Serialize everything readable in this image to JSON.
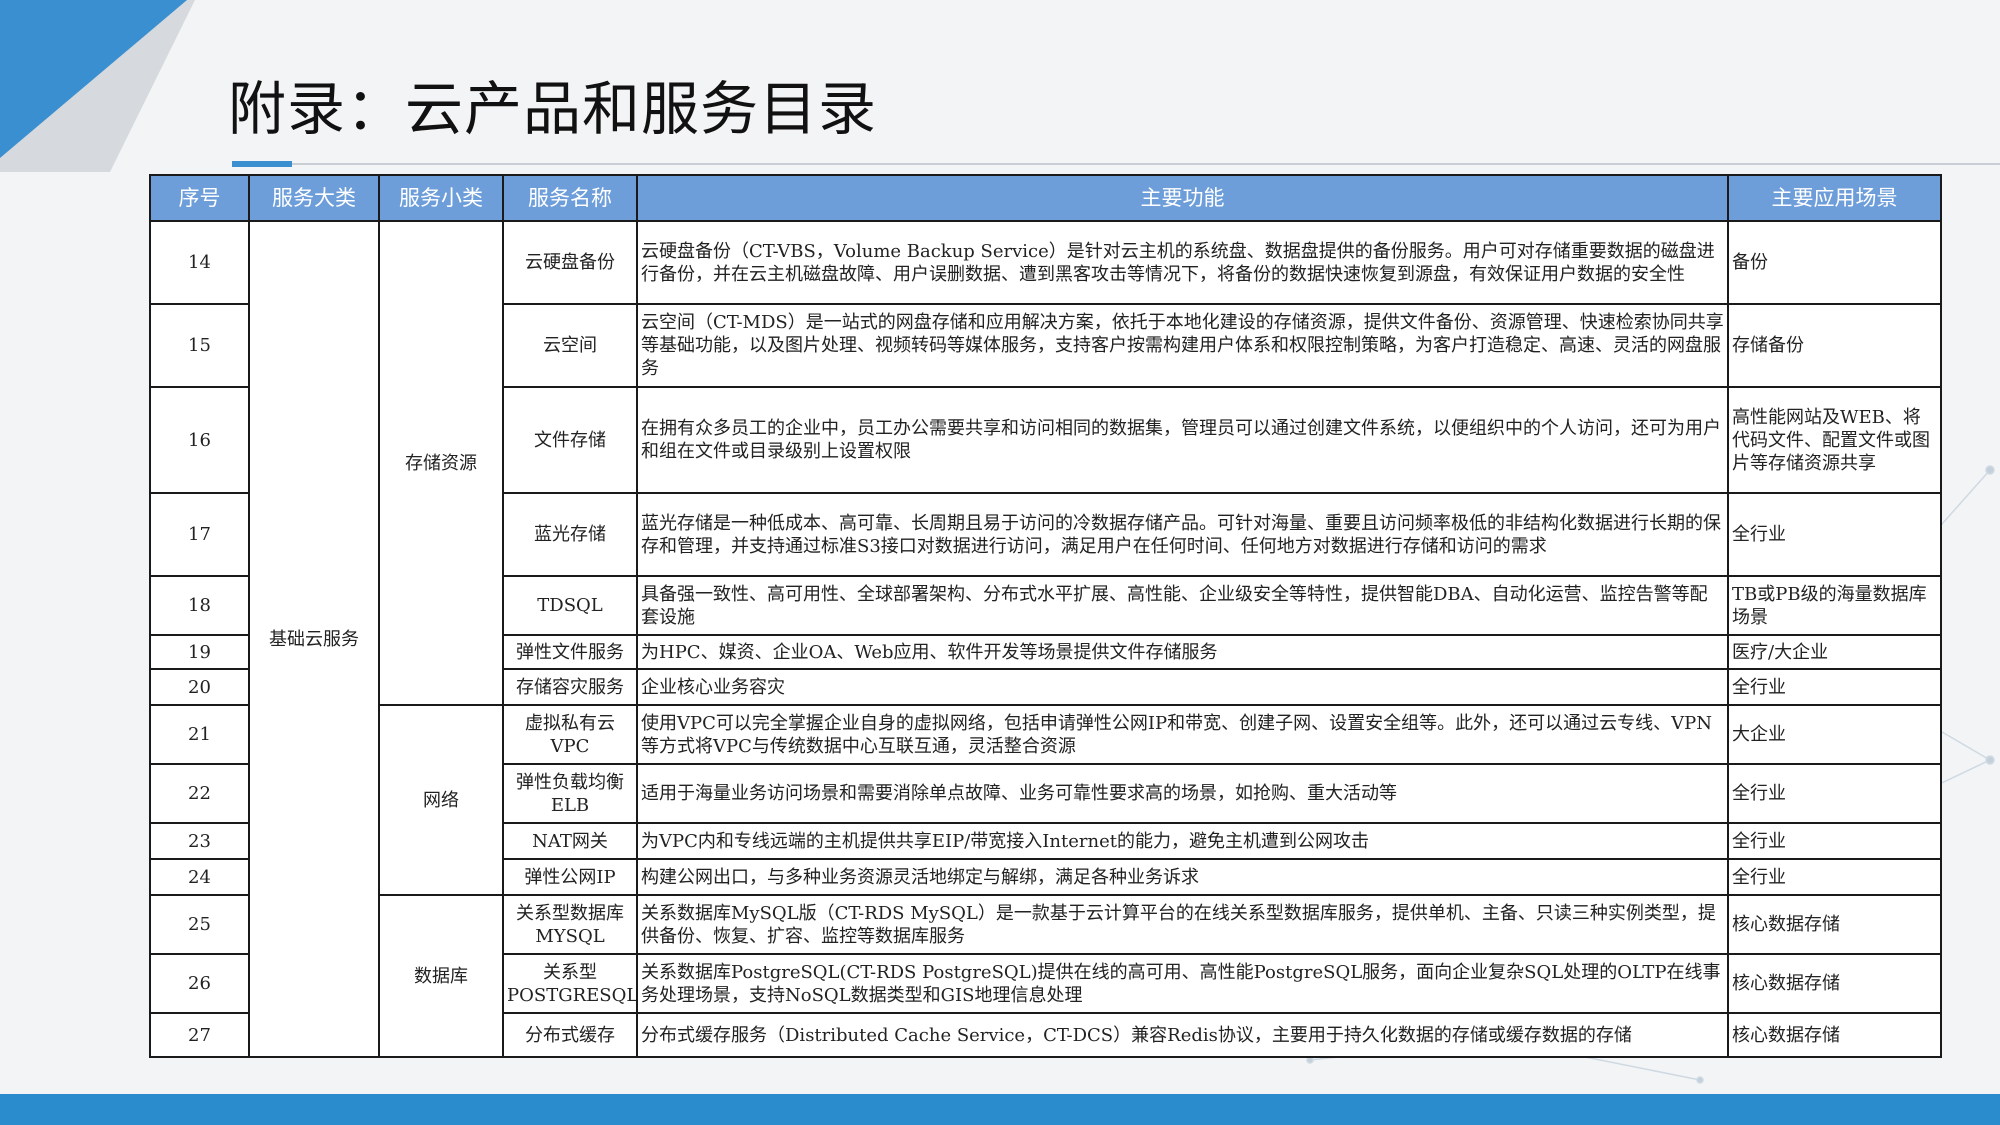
{
  "title": "附录：云产品和服务目录",
  "colors": {
    "header_bg": "#6d9eda",
    "accent": "#3a8fd0",
    "bottom_bar": "#2a8ccc"
  },
  "table": {
    "headers": [
      "序号",
      "服务大类",
      "服务小类",
      "服务名称",
      "主要功能",
      "主要应用场景"
    ],
    "category": "基础云服务",
    "subcategories": [
      "存储资源",
      "网络",
      "数据库"
    ],
    "rows": [
      {
        "no": "14",
        "name": "云硬盘备份",
        "func": "云硬盘备份（CT-VBS，Volume Backup Service）是针对云主机的系统盘、数据盘提供的备份服务。用户可对存储重要数据的磁盘进行备份，并在云主机磁盘故障、用户误删数据、遭到黑客攻击等情况下，将备份的数据快速恢复到源盘，有效保证用户数据的安全性",
        "scene": "备份"
      },
      {
        "no": "15",
        "name": "云空间",
        "func": "云空间（CT-MDS）是一站式的网盘存储和应用解决方案，依托于本地化建设的存储资源，提供文件备份、资源管理、快速检索协同共享等基础功能，以及图片处理、视频转码等媒体服务，支持客户按需构建用户体系和权限控制策略，为客户打造稳定、高速、灵活的网盘服务",
        "scene": "存储备份"
      },
      {
        "no": "16",
        "name": "文件存储",
        "func": "在拥有众多员工的企业中，员工办公需要共享和访问相同的数据集，管理员可以通过创建文件系统，以便组织中的个人访问，还可为用户和组在文件或目录级别上设置权限",
        "scene": "高性能网站及WEB、将代码文件、配置文件或图片等存储资源共享"
      },
      {
        "no": "17",
        "name": "蓝光存储",
        "func": "蓝光存储是一种低成本、高可靠、长周期且易于访问的冷数据存储产品。可针对海量、重要且访问频率极低的非结构化数据进行长期的保存和管理，并支持通过标准S3接口对数据进行访问，满足用户在任何时间、任何地方对数据进行存储和访问的需求",
        "scene": "全行业"
      },
      {
        "no": "18",
        "name": "TDSQL",
        "func": "具备强一致性、高可用性、全球部署架构、分布式水平扩展、高性能、企业级安全等特性，提供智能DBA、自动化运营、监控告警等配套设施",
        "scene": "TB或PB级的海量数据库场景"
      },
      {
        "no": "19",
        "name": "弹性文件服务",
        "func": "为HPC、媒资、企业OA、Web应用、软件开发等场景提供文件存储服务",
        "scene": "医疗/大企业"
      },
      {
        "no": "20",
        "name": "存储容灾服务",
        "func": "企业核心业务容灾",
        "scene": "全行业"
      },
      {
        "no": "21",
        "name": "虚拟私有云VPC",
        "func": "使用VPC可以完全掌握企业自身的虚拟网络，包括申请弹性公网IP和带宽、创建子网、设置安全组等。此外，还可以通过云专线、VPN等方式将VPC与传统数据中心互联互通，灵活整合资源",
        "scene": "大企业"
      },
      {
        "no": "22",
        "name": "弹性负载均衡ELB",
        "func": "适用于海量业务访问场景和需要消除单点故障、业务可靠性要求高的场景，如抢购、重大活动等",
        "scene": "全行业"
      },
      {
        "no": "23",
        "name": "NAT网关",
        "func": "为VPC内和专线远端的主机提供共享EIP/带宽接入Internet的能力，避免主机遭到公网攻击",
        "scene": "全行业"
      },
      {
        "no": "24",
        "name": "弹性公网IP",
        "func": "构建公网出口，与多种业务资源灵活地绑定与解绑，满足各种业务诉求",
        "scene": "全行业"
      },
      {
        "no": "25",
        "name": "关系型数据库MYSQL",
        "func": "关系数据库MySQL版（CT-RDS MySQL）是一款基于云计算平台的在线关系型数据库服务，提供单机、主备、只读三种实例类型，提供备份、恢复、扩容、监控等数据库服务",
        "scene": "核心数据存储"
      },
      {
        "no": "26",
        "name": "关系型POSTGRESQL",
        "func": "关系数据库PostgreSQL(CT-RDS PostgreSQL)提供在线的高可用、高性能PostgreSQL服务，面向企业复杂SQL处理的OLTP在线事务处理场景，支持NoSQL数据类型和GIS地理信息处理",
        "scene": "核心数据存储"
      },
      {
        "no": "27",
        "name": "分布式缓存",
        "func": "分布式缓存服务（Distributed Cache Service，CT-DCS）兼容Redis协议，主要用于持久化数据的存储或缓存数据的存储",
        "scene": "核心数据存储"
      }
    ]
  }
}
